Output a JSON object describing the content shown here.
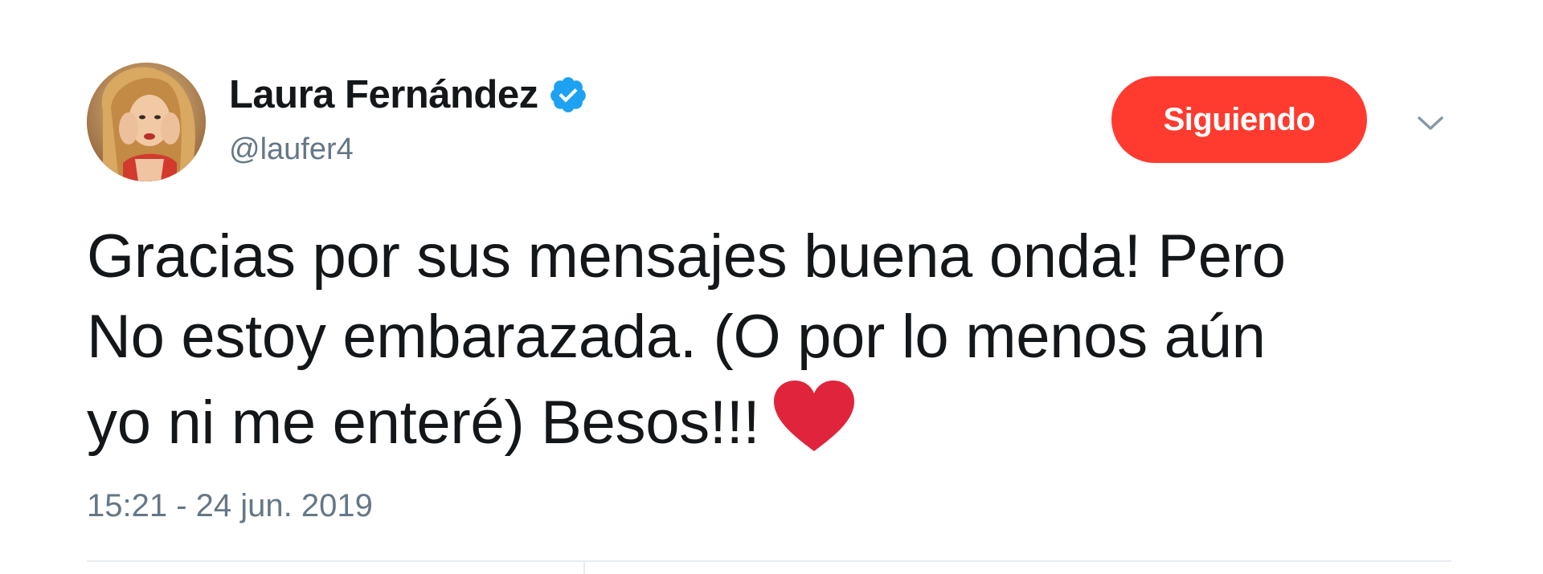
{
  "author": {
    "display_name": "Laura Fernández",
    "handle": "@laufer4",
    "verified": true,
    "avatar_icon": "profile-photo"
  },
  "follow_button": {
    "label": "Siguiendo",
    "color": "#ff3b2f"
  },
  "menu": {
    "icon": "chevron-down-icon"
  },
  "tweet": {
    "lines": [
      "Gracias por sus mensajes buena onda! Pero",
      "No estoy embarazada. (O por lo menos aún",
      "yo ni me enteré) Besos!!!"
    ],
    "emoji": "red-heart-icon",
    "timestamp": "15:21 - 24 jun. 2019"
  },
  "colors": {
    "text": "#14171a",
    "secondary_text": "#657786",
    "verified_blue": "#1da1f2",
    "heart_red": "#e0243b",
    "divider": "#e6ecf0"
  }
}
